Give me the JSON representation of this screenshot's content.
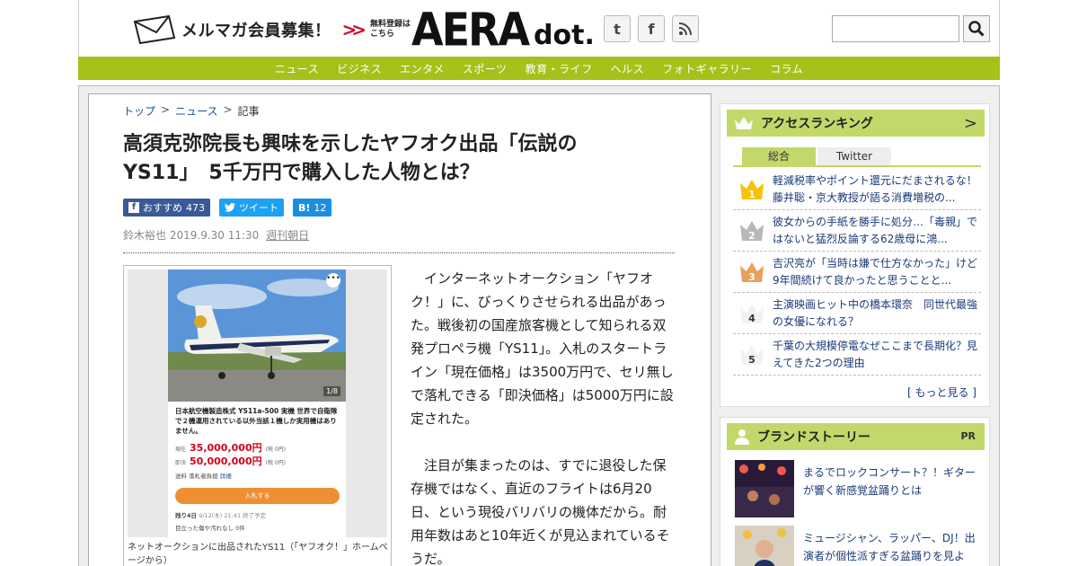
{
  "header": {
    "mailmag_label": "メルマガ会員募集！",
    "free_register": "無料登録は\nこちら",
    "logo_main": "AERA",
    "logo_sub": "dot.",
    "social": [
      {
        "name": "twitter-icon",
        "glyph": "t"
      },
      {
        "name": "facebook-icon",
        "glyph": "f"
      },
      {
        "name": "rss-icon",
        "glyph": "))"
      }
    ],
    "search_placeholder": ""
  },
  "nav": {
    "items": [
      "ニュース",
      "ビジネス",
      "エンタメ",
      "スポーツ",
      "教育・ライフ",
      "ヘルス",
      "フォトギャラリー",
      "コラム"
    ]
  },
  "breadcrumb": {
    "top": "トップ",
    "news": "ニュース",
    "current": "記事"
  },
  "article": {
    "title_line1": "高須克弥院長も興味を示したヤフオク出品「伝説の",
    "title_line2": "YS11」　5千万円で購入した人物とは？",
    "share": {
      "fb_label": "おすすめ",
      "fb_count": "473",
      "tw_label": "ツイート",
      "hb_label": "B!",
      "hb_count": "12"
    },
    "author": "鈴木裕也",
    "date": "2019.9.30 11:30",
    "publication": "週刊朝日",
    "paragraphs": [
      "インターネットオークション「ヤフオク！」に、びっくりさせられる出品があった。戦後初の国産旅客機として知られる双発プロペラ機「YS11」。入札のスタートライン「現在価格」は3500万円で、セリ無しで落札できる「即決価格」は5000万円に設定された。",
      "注目が集まったのは、すでに退役した保存機ではなく、直近のフライトは6月20日、という現役バリバリの機体だから。耐用年数はあと10年近くが見込まれているそうだ。"
    ],
    "figure": {
      "photo_counter": "1/8",
      "more_glyph": "•••",
      "listing_title": "日本航空機製造株式 YS11a-500 実機 世界で自衛隊で２機運用されている以外当該１機しか実用機はありません。",
      "current_label": "現在",
      "current_price": "35,000,000円",
      "current_tax": "(税 0円)",
      "buyout_label": "即決",
      "buyout_price": "50,000,000円",
      "buyout_tax": "(税 0円)",
      "shipping": "送料 落札者負担",
      "shipping_link": "詳細",
      "bid_label": "入札する",
      "remaining": "残り4日",
      "remaining_detail": "9/12(木) 21:41 終了予定",
      "footer": "目立った傷や汚れなし",
      "footer_count": "0件",
      "caption": "ネットオークションに出品されたYS11（「ヤフオク！」ホームページから）"
    }
  },
  "ranking": {
    "title": "アクセスランキング",
    "tabs": [
      "総合",
      "Twitter"
    ],
    "items": [
      {
        "rank": "1",
        "text": "軽減税率やポイント還元にだまされるな！藤井聡・京大教授が語る消費増税の..."
      },
      {
        "rank": "2",
        "text": "彼女からの手紙を勝手に処分…「毒親」ではないと猛烈反論する62歳母に鴻..."
      },
      {
        "rank": "3",
        "text": "吉沢亮が「当時は嫌で仕方なかった」けど9年間続けて良かったと思うことと..."
      },
      {
        "rank": "4",
        "text": "主演映画ヒット中の橋本環奈　同世代最強の女優になれる？"
      },
      {
        "rank": "5",
        "text": "千葉の大規模停電なぜここまで長期化？見えてきた2つの理由"
      }
    ],
    "more": "[ もっと見る ]",
    "colors": {
      "gold": "#f5c400",
      "silver": "#b8b8b8",
      "bronze": "#e8a05a"
    }
  },
  "brand": {
    "title": "ブランドストーリー",
    "pr": "PR",
    "items": [
      {
        "text": "まるでロックコンサート？！ギターが響く新感覚盆踊りとは"
      },
      {
        "text": "ミュージシャン、ラッパー、DJ！出演者が個性派すぎる盆踊りを見よ"
      }
    ]
  },
  "colors": {
    "accent": "#a6c11a",
    "side_head": "#c3d86a",
    "link": "#1a3a7a"
  }
}
